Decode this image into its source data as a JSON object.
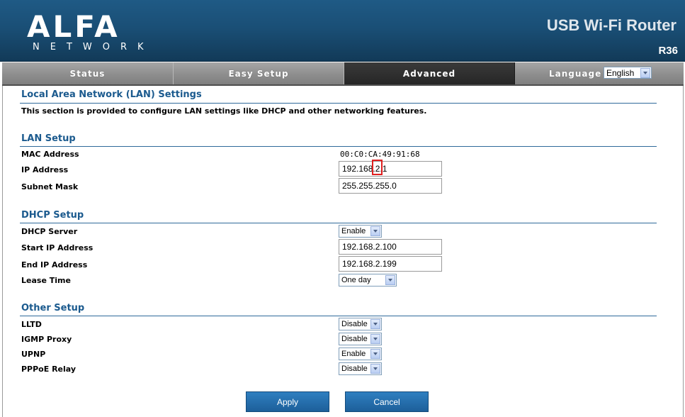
{
  "brand": {
    "logo_text": "ALFA",
    "logo_sub": "NETWORK",
    "product_title": "USB Wi-Fi Router",
    "model": "R36"
  },
  "nav": {
    "tabs": [
      {
        "label": "Status",
        "active": false
      },
      {
        "label": "Easy Setup",
        "active": false
      },
      {
        "label": "Advanced",
        "active": true
      }
    ],
    "language_label": "Language",
    "language_value": "English"
  },
  "page": {
    "title": "Local Area Network (LAN) Settings",
    "description": "This section is provided to configure LAN settings like DHCP and other networking features."
  },
  "lan_setup": {
    "heading": "LAN Setup",
    "mac_label": "MAC Address",
    "mac_value": "00:C0:CA:49:91:68",
    "ip_label": "IP Address",
    "ip_value": "192.168.2.1",
    "subnet_label": "Subnet Mask",
    "subnet_value": "255.255.255.0"
  },
  "dhcp_setup": {
    "heading": "DHCP Setup",
    "server_label": "DHCP Server",
    "server_value": "Enable",
    "start_label": "Start IP Address",
    "start_value": "192.168.2.100",
    "end_label": "End IP Address",
    "end_value": "192.168.2.199",
    "lease_label": "Lease Time",
    "lease_value": "One day"
  },
  "other_setup": {
    "heading": "Other Setup",
    "lltd_label": "LLTD",
    "lltd_value": "Disable",
    "igmp_label": "IGMP Proxy",
    "igmp_value": "Disable",
    "upnp_label": "UPNP",
    "upnp_value": "Enable",
    "pppoe_label": "PPPoE Relay",
    "pppoe_value": "Disable"
  },
  "buttons": {
    "apply": "Apply",
    "cancel": "Cancel"
  },
  "colors": {
    "header_blue": "#1a4f76",
    "section_blue": "#1b5a8e",
    "button_blue": "#1d5f9a",
    "highlight_red": "#e02020"
  }
}
